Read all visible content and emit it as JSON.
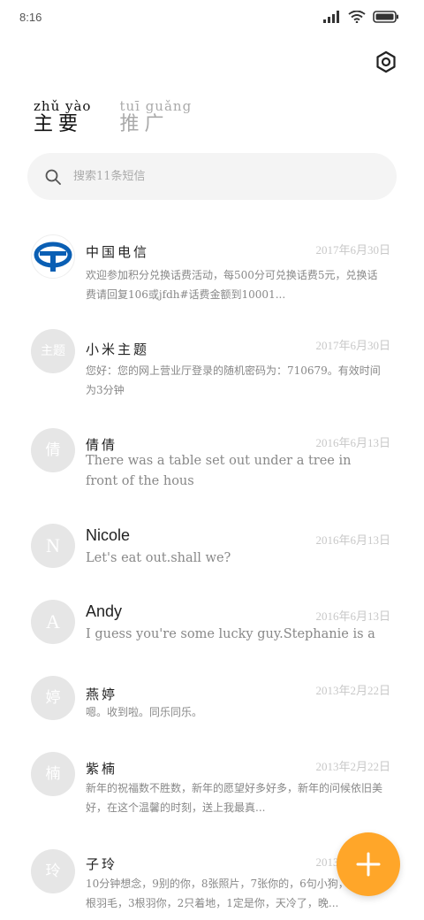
{
  "status_bar": {
    "time": "8:16"
  },
  "tabs": [
    {
      "pinyin": "zhǔ yào",
      "label": "主要"
    },
    {
      "pinyin": "tuī guǎng",
      "label": "推广"
    }
  ],
  "search": {
    "placeholder": "搜索11条短信"
  },
  "conversations": [
    {
      "avatar_text": "",
      "name": "中国电信",
      "date": "2017年6月30日",
      "message": "欢迎参加积分兑换话费活动，每500分可兑换话费5元，兑换话费请回复106或jfdh#话费金额到10001..."
    },
    {
      "avatar_text": "主题",
      "name": "小米主题",
      "date": "2017年6月30日",
      "message": "您好：您的网上营业厅登录的随机密码为：710679。有效时间为3分钟"
    },
    {
      "avatar_text": "倩",
      "name": "倩倩",
      "date": "2016年6月13日",
      "message": "There was a table set out under a tree in front of the hous"
    },
    {
      "avatar_text": "N",
      "name": "Nicole",
      "date": "2016年6月13日",
      "message": "Let's eat out.shall we?"
    },
    {
      "avatar_text": "A",
      "name": "Andy",
      "date": "2016年6月13日",
      "message": "I guess you're some lucky guy.Stephanie is a nice girl."
    },
    {
      "avatar_text": "婷",
      "name": "燕婷",
      "date": "2013年2月22日",
      "message": "嗯。收到啦。同乐同乐。"
    },
    {
      "avatar_text": "楠",
      "name": "紫楠",
      "date": "2013年2月22日",
      "message": "新年的祝福数不胜数，新年的愿望好多好多，新年的问候依旧美好，在这个温馨的时刻，送上我最真..."
    },
    {
      "avatar_text": "玲",
      "name": "子玲",
      "date": "2013年2月22日",
      "message": "10分钟想念，9别的你，8张照片，7张你的，6句小狗，你，4根羽毛，3根羽你，2只着地，1定是你，天冷了，晚..."
    }
  ],
  "colors": {
    "accent": "#ffa629",
    "brand_telecom": "#0a5fb4"
  },
  "icons": {
    "settings": "hexagon-gear-icon",
    "search": "search-icon",
    "fab": "plus-icon"
  }
}
